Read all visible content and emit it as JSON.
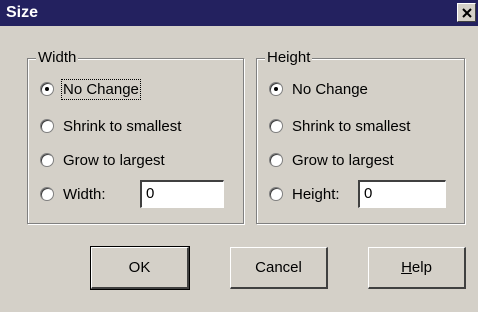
{
  "dialog": {
    "title": "Size",
    "close_icon": "close-icon"
  },
  "width_group": {
    "label": "Width",
    "options": [
      "No Change",
      "Shrink to smallest",
      "Grow to largest",
      "Width:"
    ],
    "selected_index": 0,
    "value": "0"
  },
  "height_group": {
    "label": "Height",
    "options": [
      "No Change",
      "Shrink to smallest",
      "Grow to largest",
      "Height:"
    ],
    "selected_index": 0,
    "value": "0"
  },
  "buttons": {
    "ok": "OK",
    "cancel": "Cancel",
    "help_mnemonic": "H",
    "help_rest": "elp"
  }
}
